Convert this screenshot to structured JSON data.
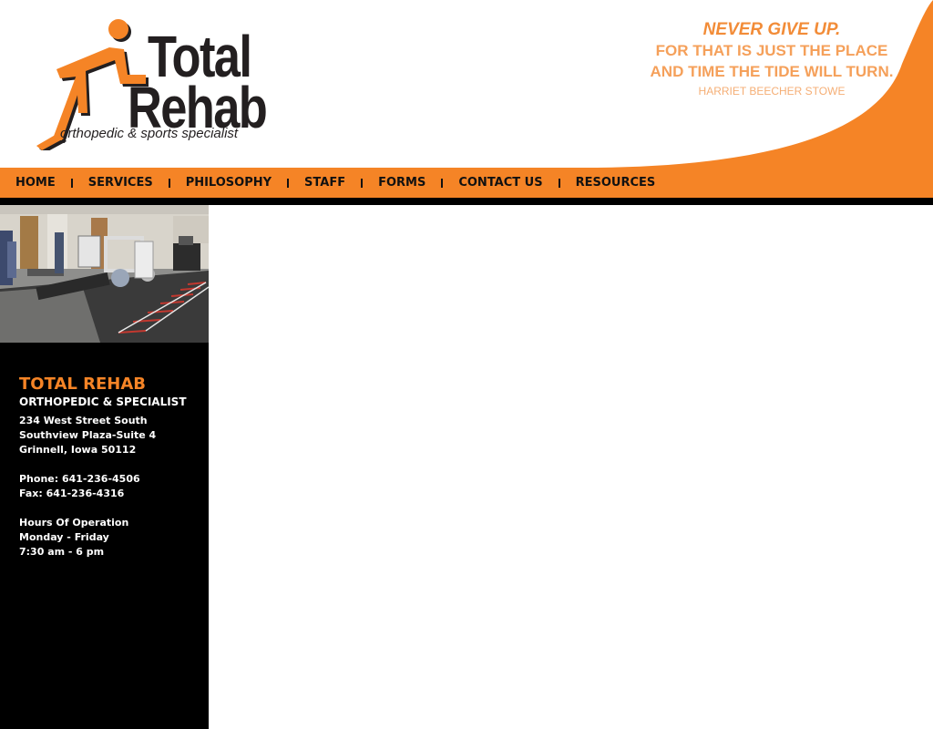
{
  "brand": {
    "name_line1": "Total",
    "name_line2": "Rehab",
    "tagline": "orthopedic & sports specialist",
    "orange": "#f58426",
    "dark": "#231f20"
  },
  "quote": {
    "line1": "NEVER GIVE UP.",
    "line2": "FOR THAT IS JUST THE PLACE",
    "line3": "AND TIME THE TIDE WILL TURN.",
    "author": "HARRIET BEECHER STOWE"
  },
  "nav": {
    "items": [
      {
        "label": "HOME"
      },
      {
        "label": "SERVICES"
      },
      {
        "label": "PHILOSOPHY"
      },
      {
        "label": "STAFF"
      },
      {
        "label": "FORMS"
      },
      {
        "label": "CONTACT US"
      },
      {
        "label": "RESOURCES"
      }
    ]
  },
  "sidebar": {
    "photo": "gym-equipment-photo",
    "title": "TOTAL REHAB",
    "subtitle": "ORTHOPEDIC & SPECIALIST",
    "address": [
      "234 West Street South",
      "Southview Plaza-Suite 4",
      "Grinnell, Iowa 50112"
    ],
    "phone": "Phone: 641-236-4506",
    "fax": "Fax: 641-236-4316",
    "hours_title": "Hours Of Operation",
    "hours_days": "Monday - Friday",
    "hours_time": "7:30 am - 6 pm"
  }
}
